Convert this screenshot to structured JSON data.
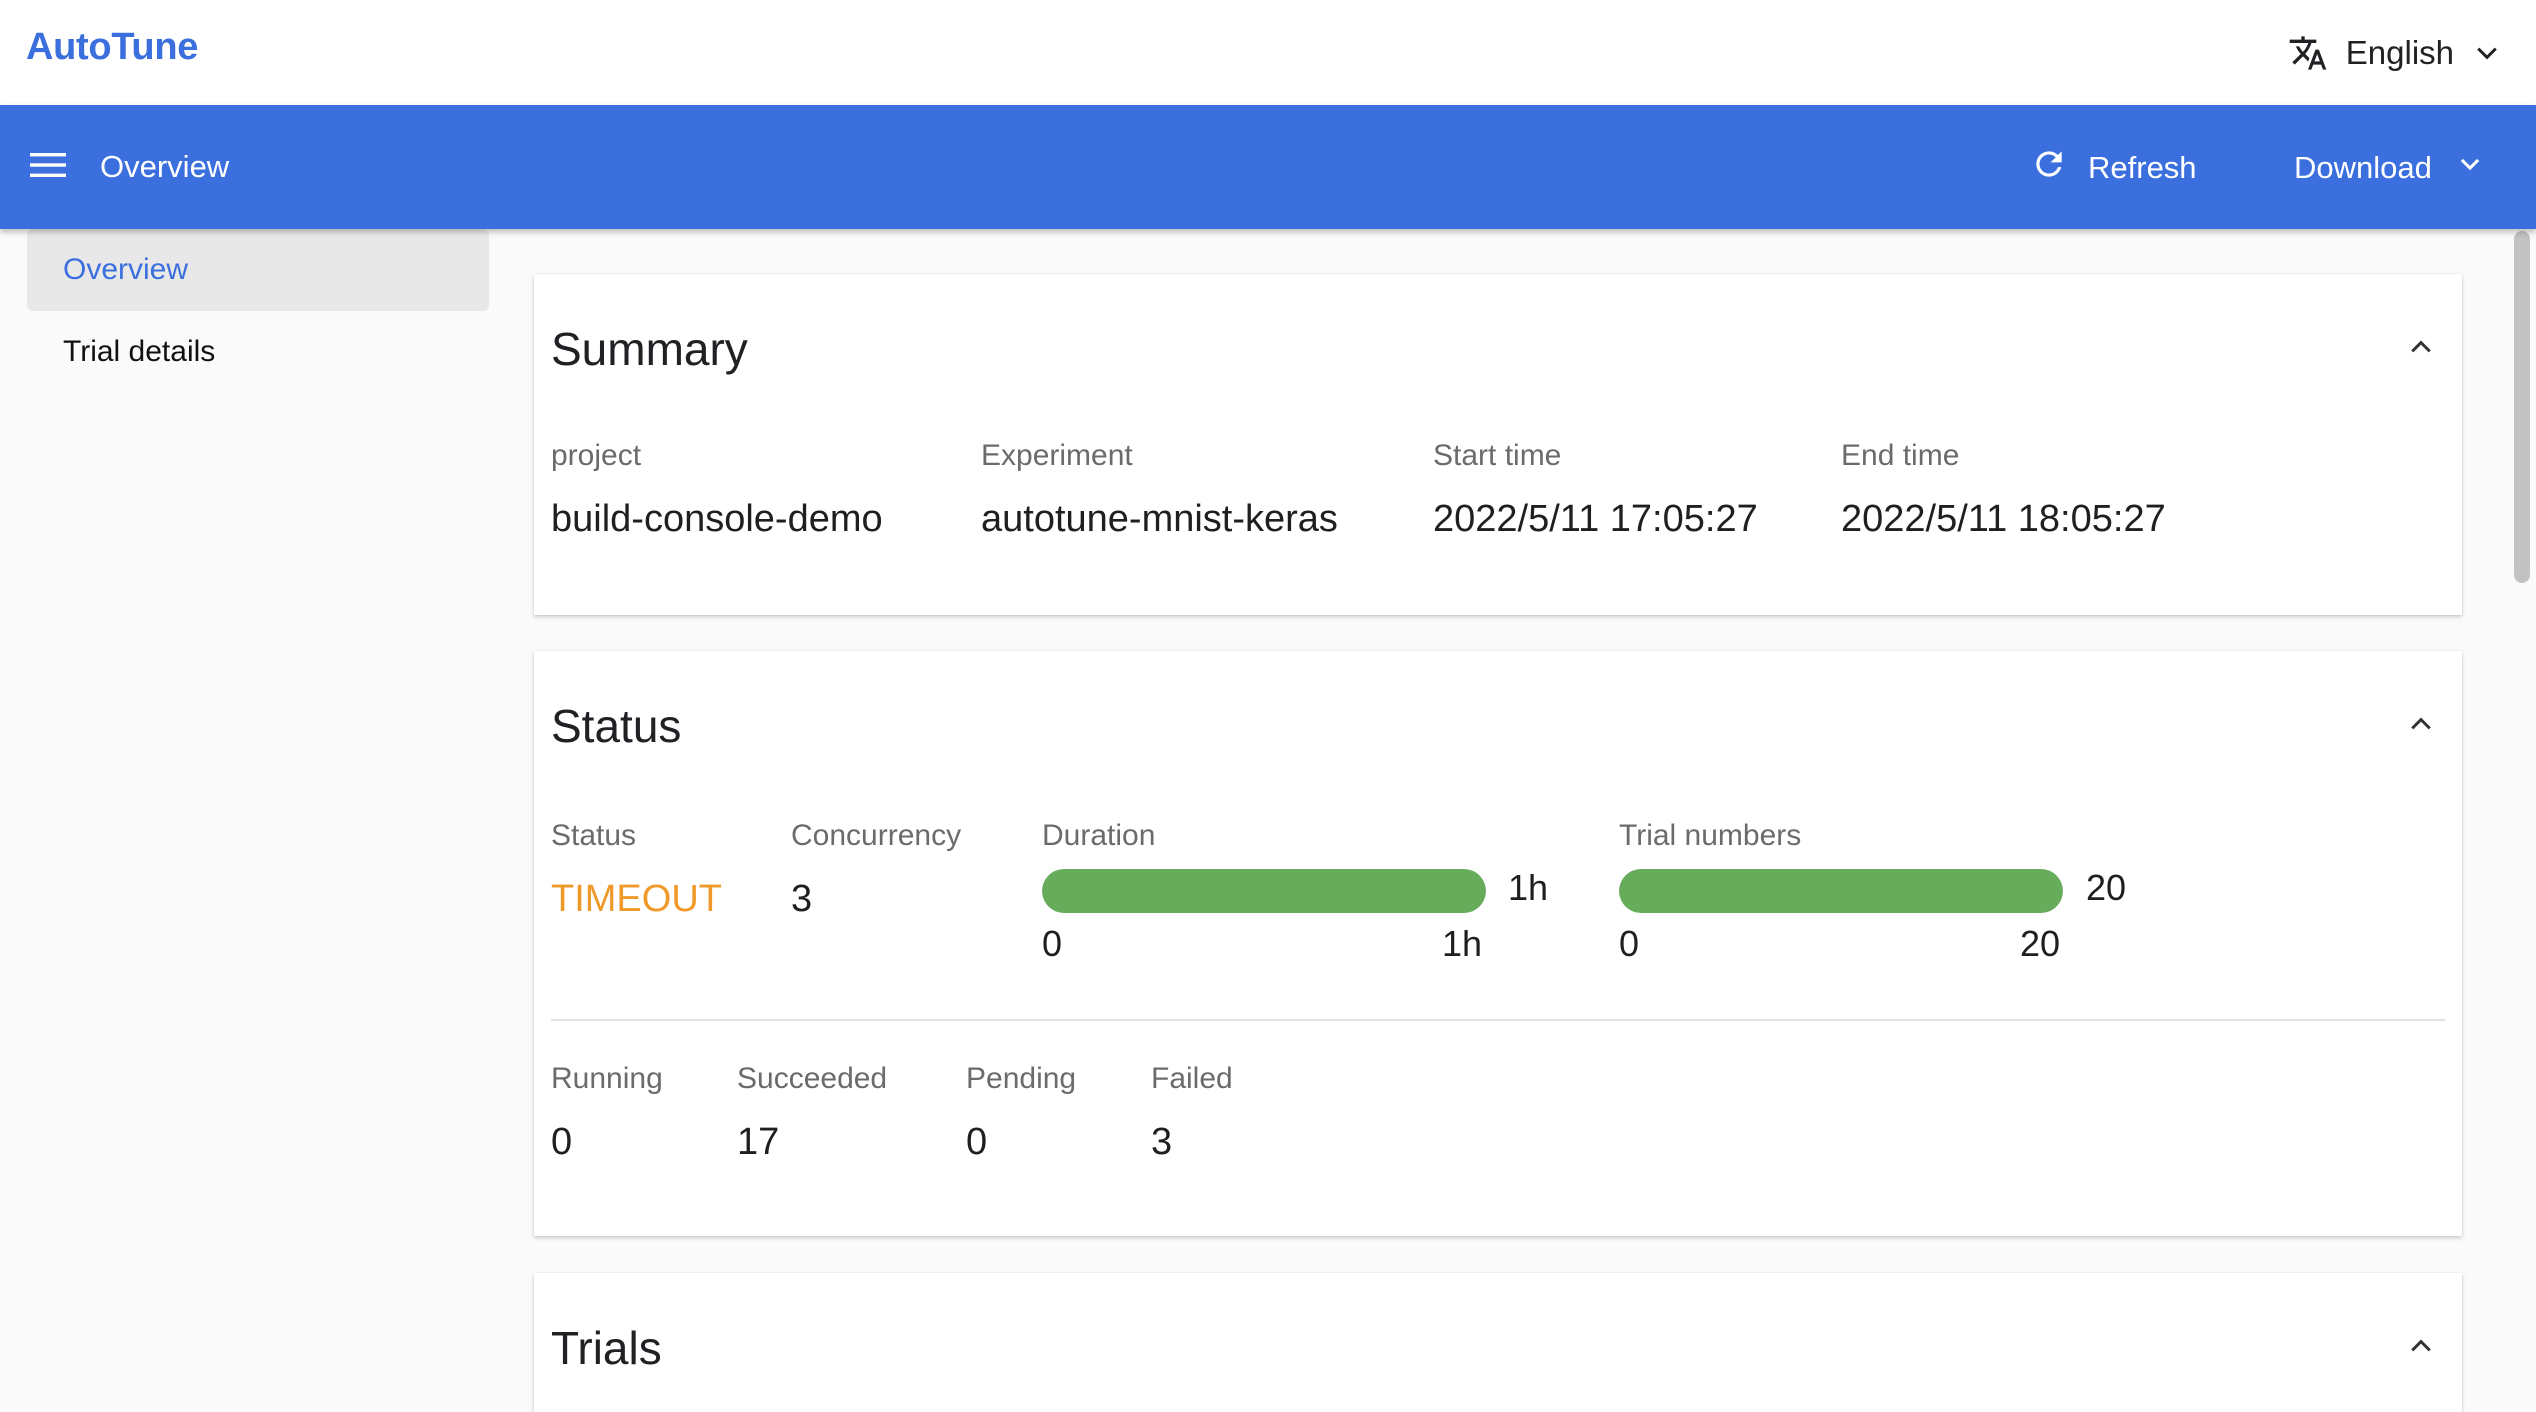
{
  "topbar": {
    "brand": "AutoTune",
    "language": "English",
    "icons": {
      "translate": "translate-icon",
      "chevron": "chevron-down-icon"
    }
  },
  "appbar": {
    "title": "Overview",
    "refresh_label": "Refresh",
    "download_label": "Download",
    "color": "#3b6fde"
  },
  "sidebar": {
    "items": [
      {
        "label": "Overview",
        "active": true
      },
      {
        "label": "Trial details",
        "active": false
      }
    ]
  },
  "summary": {
    "title": "Summary",
    "fields": [
      {
        "label": "project",
        "value": "build-console-demo"
      },
      {
        "label": "Experiment",
        "value": "autotune-mnist-keras"
      },
      {
        "label": "Start time",
        "value": "2022/5/11 17:05:27"
      },
      {
        "label": "End time",
        "value": "2022/5/11 18:05:27"
      }
    ]
  },
  "status": {
    "title": "Status",
    "status_label": "Status",
    "status_value": "TIMEOUT",
    "status_color": "#f0992b",
    "concurrency_label": "Concurrency",
    "concurrency_value": "3",
    "duration": {
      "label": "Duration",
      "current": "1h",
      "min": "0",
      "max": "1h",
      "progress": 1.0
    },
    "trial_numbers": {
      "label": "Trial numbers",
      "current": "20",
      "min": "0",
      "max": "20",
      "progress": 1.0
    },
    "progress_color": "#66ac5b",
    "counts": [
      {
        "label": "Running",
        "value": "0"
      },
      {
        "label": "Succeeded",
        "value": "17"
      },
      {
        "label": "Pending",
        "value": "0"
      },
      {
        "label": "Failed",
        "value": "3"
      }
    ]
  },
  "trials": {
    "title": "Trials"
  }
}
